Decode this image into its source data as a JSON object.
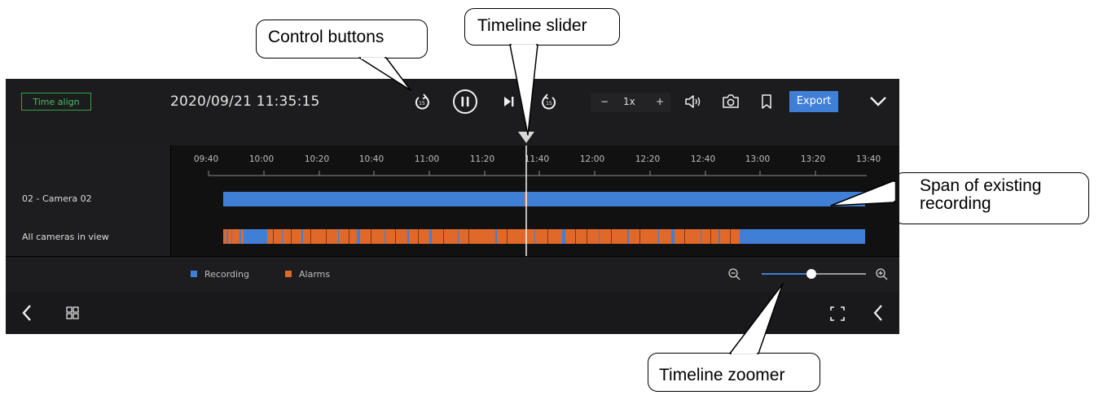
{
  "callouts": {
    "control_buttons": "Control buttons",
    "timeline_slider": "Timeline slider",
    "span_recording": "Span of existing recording",
    "timeline_zoomer": "Timeline zoomer"
  },
  "player": {
    "time_align_label": "Time align",
    "datetime": "2020/09/21 11:35:15",
    "speed": {
      "minus": "−",
      "value": "1x",
      "plus": "+"
    },
    "export_label": "Export",
    "icons": [
      "rewind-15s-icon",
      "pause-icon",
      "step-forward-icon",
      "forward-15s-icon",
      "volume-icon",
      "camera-snapshot-icon",
      "bookmark-icon",
      "chevron-down-icon",
      "chevron-left-icon",
      "grid-view-icon",
      "fullscreen-icon",
      "zoom-out-icon",
      "zoom-in-icon"
    ]
  },
  "timeline": {
    "ticks": [
      "09:40",
      "10:00",
      "10:20",
      "10:40",
      "11:00",
      "11:20",
      "11:40",
      "12:00",
      "12:20",
      "12:40",
      "13:00",
      "13:20",
      "13:40"
    ],
    "cameras": [
      "02 - Camera 02",
      "All cameras in view"
    ],
    "colors": {
      "recording": "#3f7fd6",
      "alarm": "#e0692a"
    },
    "zoom_level": 0.49
  },
  "legend": {
    "recording": "Recording",
    "alarms": "Alarms"
  }
}
